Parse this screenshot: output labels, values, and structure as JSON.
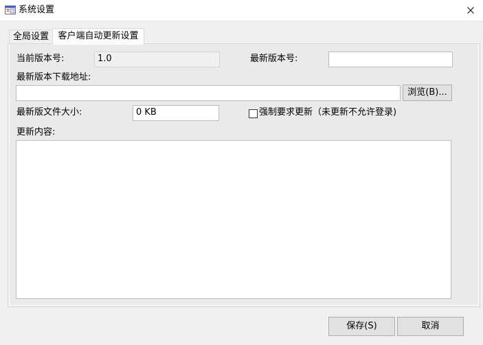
{
  "window": {
    "title": "系统设置",
    "icon": "app-window-icon",
    "close_icon": "close-icon"
  },
  "tabs": [
    {
      "label": "全局设置",
      "active": false
    },
    {
      "label": "客户端自动更新设置",
      "active": true
    }
  ],
  "form": {
    "current_version_label": "当前版本号:",
    "current_version_value": "1.0",
    "latest_version_label": "最新版本号:",
    "latest_version_value": "",
    "download_url_label": "最新版本下载地址:",
    "download_url_value": "",
    "browse_label": "浏览(B)...",
    "file_size_label": "最新版文件大小:",
    "file_size_value": "0 KB",
    "force_update_label": "强制要求更新（未更新不允许登录)",
    "force_update_checked": false,
    "update_content_label": "更新内容:",
    "update_content_value": ""
  },
  "footer": {
    "save_label": "保存(S)",
    "cancel_label": "取消"
  }
}
